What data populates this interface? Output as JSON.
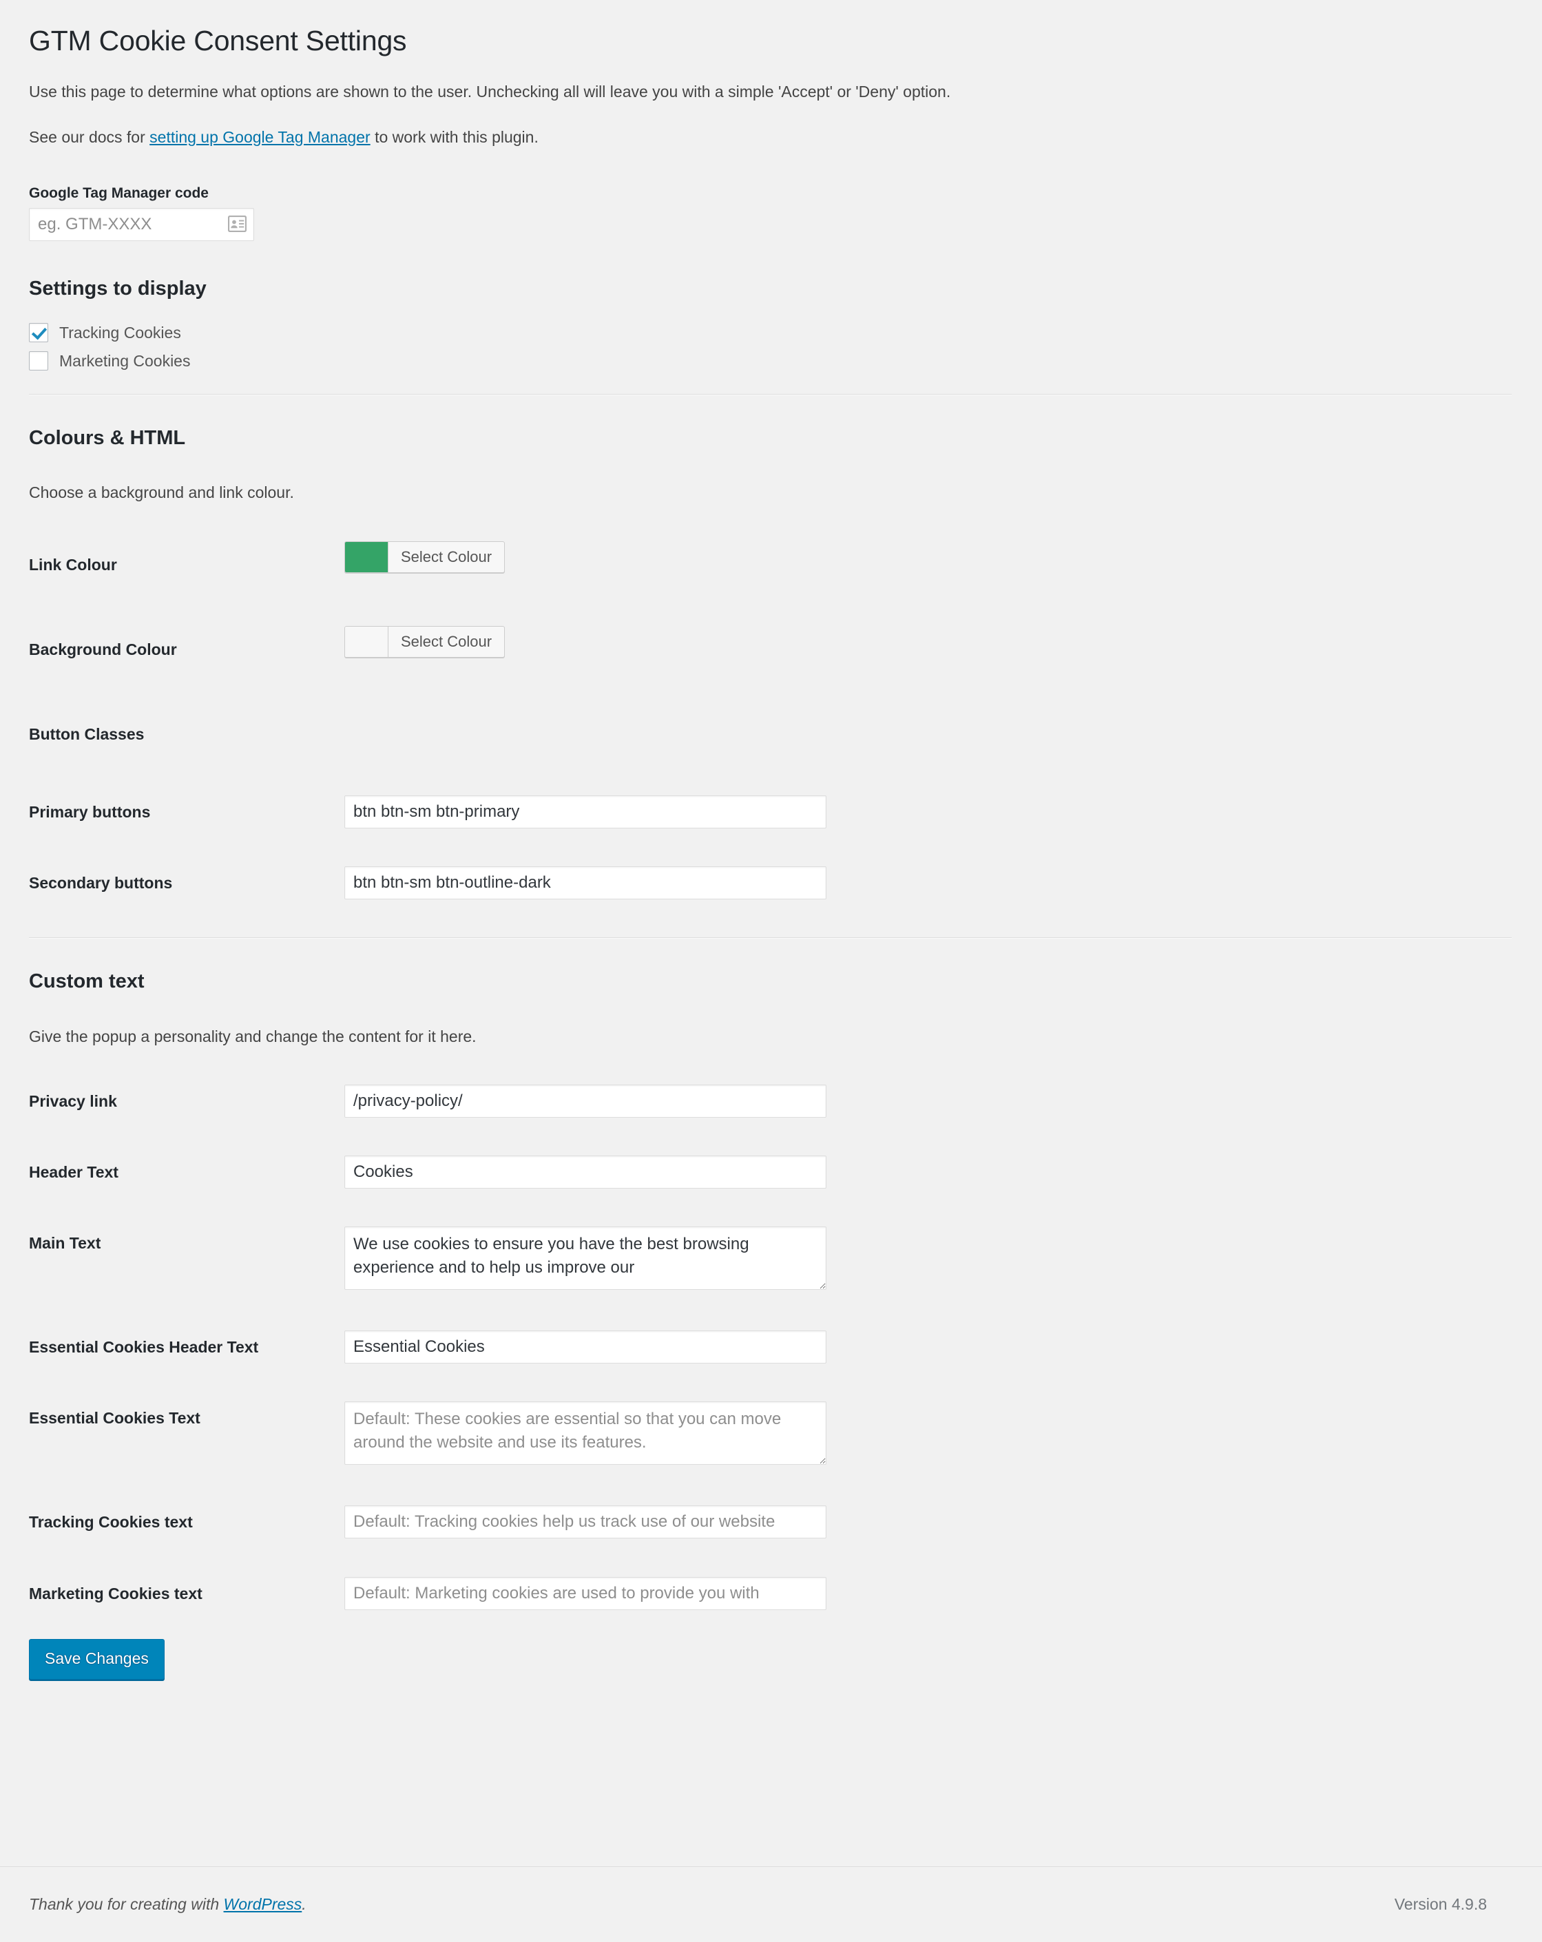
{
  "page": {
    "title": "GTM Cookie Consent Settings",
    "intro_line1": "Use this page to determine what options are shown to the user. Unchecking all will leave you with a simple 'Accept' or 'Deny' option.",
    "intro_line2_prefix": "See our docs for ",
    "intro_line2_link": "setting up Google Tag Manager",
    "intro_line2_suffix": " to work with this plugin."
  },
  "gtm": {
    "label": "Google Tag Manager code",
    "placeholder": "eg. GTM-XXXX",
    "value": "",
    "autofill_icon": "contact-card-icon"
  },
  "settings_to_display": {
    "heading": "Settings to display",
    "options": [
      {
        "label": "Tracking Cookies",
        "checked": true
      },
      {
        "label": "Marketing Cookies",
        "checked": false
      }
    ]
  },
  "colours": {
    "heading": "Colours & HTML",
    "description": "Choose a background and link colour.",
    "link_colour": {
      "label": "Link Colour",
      "button_label": "Select Colour",
      "value": "#34a467"
    },
    "background_colour": {
      "label": "Background Colour",
      "button_label": "Select Colour",
      "value": "#f7f7f7"
    },
    "button_classes": {
      "label": "Button Classes",
      "primary": {
        "label": "Primary buttons",
        "value": "btn btn-sm btn-primary"
      },
      "secondary": {
        "label": "Secondary buttons",
        "value": "btn btn-sm btn-outline-dark"
      }
    }
  },
  "custom_text": {
    "heading": "Custom text",
    "description": "Give the popup a personality and change the content for it here.",
    "fields": [
      {
        "label": "Privacy link",
        "value": "/privacy-policy/",
        "placeholder": ""
      },
      {
        "label": "Header Text",
        "value": "Cookies",
        "placeholder": ""
      },
      {
        "label": "Main Text",
        "value": "We use cookies to ensure you have the best browsing experience and to help us improve our",
        "placeholder": ""
      },
      {
        "label": "Essential Cookies Header Text",
        "value": "Essential Cookies",
        "placeholder": ""
      },
      {
        "label": "Essential Cookies Text",
        "value": "",
        "placeholder": "Default: These cookies are essential so that you can move around the website and use its features."
      },
      {
        "label": "Tracking Cookies text",
        "value": "",
        "placeholder": "Default: Tracking cookies help us track use of our website"
      },
      {
        "label": "Marketing Cookies text",
        "value": "",
        "placeholder": "Default: Marketing cookies are used to provide you with"
      }
    ]
  },
  "submit": {
    "save_label": "Save Changes"
  },
  "footer": {
    "thanks_prefix": "Thank you for creating with ",
    "thanks_link": "WordPress",
    "thanks_suffix": ".",
    "version": "Version 4.9.8"
  },
  "colors": {
    "accent_blue": "#0085ba",
    "link_blue": "#0073aa",
    "checkbox_blue": "#1e8cbe",
    "page_bg": "#f1f1f1",
    "heading": "#23282d"
  }
}
